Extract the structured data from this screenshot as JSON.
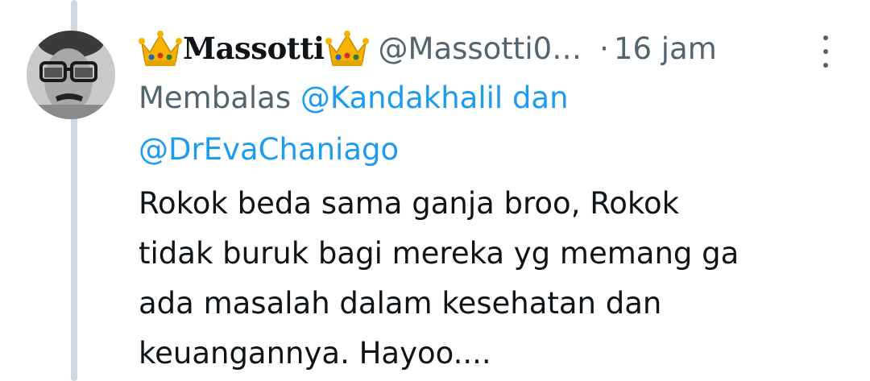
{
  "tweet": {
    "display_name": "Massotti",
    "handle": "@Massotti0…",
    "separator": "·",
    "time": "16 jam",
    "reply_prefix": "Membalas",
    "reply_mention_1": "@Kandakhalil dan",
    "reply_mention_2": "@DrEvaChaniago",
    "text_lines": [
      "Rokok beda sama ganja broo, Rokok",
      "tidak buruk bagi mereka yg memang ga",
      "ada masalah dalam kesehatan dan",
      "keuangannya. Hayoo...."
    ]
  },
  "icons": {
    "crown_left": "crown-icon",
    "crown_right": "crown-icon",
    "more": "more-vertical-icon"
  },
  "colors": {
    "text": "#0f1419",
    "muted": "#536471",
    "link": "#1d9bf0",
    "thread_line": "#cfd9de"
  }
}
